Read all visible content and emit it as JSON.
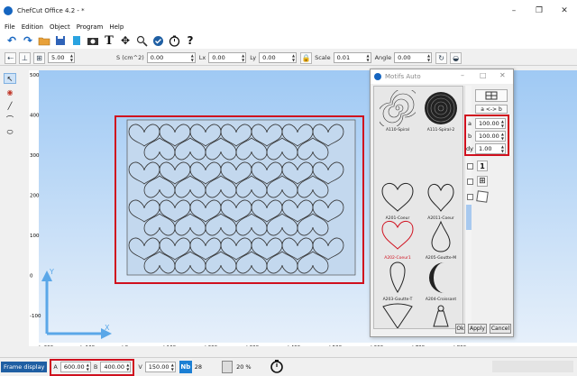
{
  "window": {
    "title": "ChefCut Office 4.2 - *",
    "controls": [
      "–",
      "❐",
      "✕"
    ]
  },
  "menu": [
    "File",
    "Edition",
    "Object",
    "Program",
    "Help"
  ],
  "toolbar": {
    "text_tool": "T",
    "help_tool": "?"
  },
  "params": {
    "thickness": "5.00",
    "area_label": "S (cm^2)",
    "area": "0.00",
    "lx_label": "Lx",
    "lx": "0.00",
    "ly_label": "Ly",
    "ly": "0.00",
    "scale_label": "Scale",
    "scale": "0.01",
    "angle_label": "Angle",
    "angle": "0.00"
  },
  "canvas": {
    "background": "#cfe2f6",
    "y_ticks": [
      "500",
      "400",
      "300",
      "200",
      "100",
      "0",
      "-100"
    ],
    "x_ticks": [
      "-200",
      "-100",
      "0",
      "100",
      "200",
      "300",
      "400",
      "500",
      "600",
      "700",
      "800"
    ],
    "axis_x_label": "X",
    "axis_y_label": "Y"
  },
  "dialog": {
    "title": "Motifs Auto",
    "motifs": [
      {
        "name": "A110-Spiral"
      },
      {
        "name": "A111-Spiral-2"
      },
      {
        "name": "A201-Coeur"
      },
      {
        "name": "A2011-Coeur"
      },
      {
        "name": "A202-Coeur1",
        "selected": true
      },
      {
        "name": "A205-Goutte-M"
      },
      {
        "name": "A203-Goutte-T"
      },
      {
        "name": "A204-Croissant"
      }
    ],
    "swap_label": "a <-> b",
    "a_label": "a",
    "a_value": "100.00",
    "b_label": "b",
    "b_value": "100.00",
    "dy_label": "dy",
    "dy_value": "1.00",
    "opt_number": "1",
    "ok": "Ok",
    "apply": "Apply",
    "cancel": "Cancel"
  },
  "status": {
    "frame_display": "Frame display",
    "a_label": "A",
    "a_value": "600.00",
    "b_label": "B",
    "b_value": "400.00",
    "v_label": "V",
    "v_value": "150.00",
    "count": "28",
    "zoom": "20 %"
  },
  "colors": {
    "accent": "#1565c0",
    "highlight": "#d0101e",
    "selection": "#1f5fa3"
  }
}
